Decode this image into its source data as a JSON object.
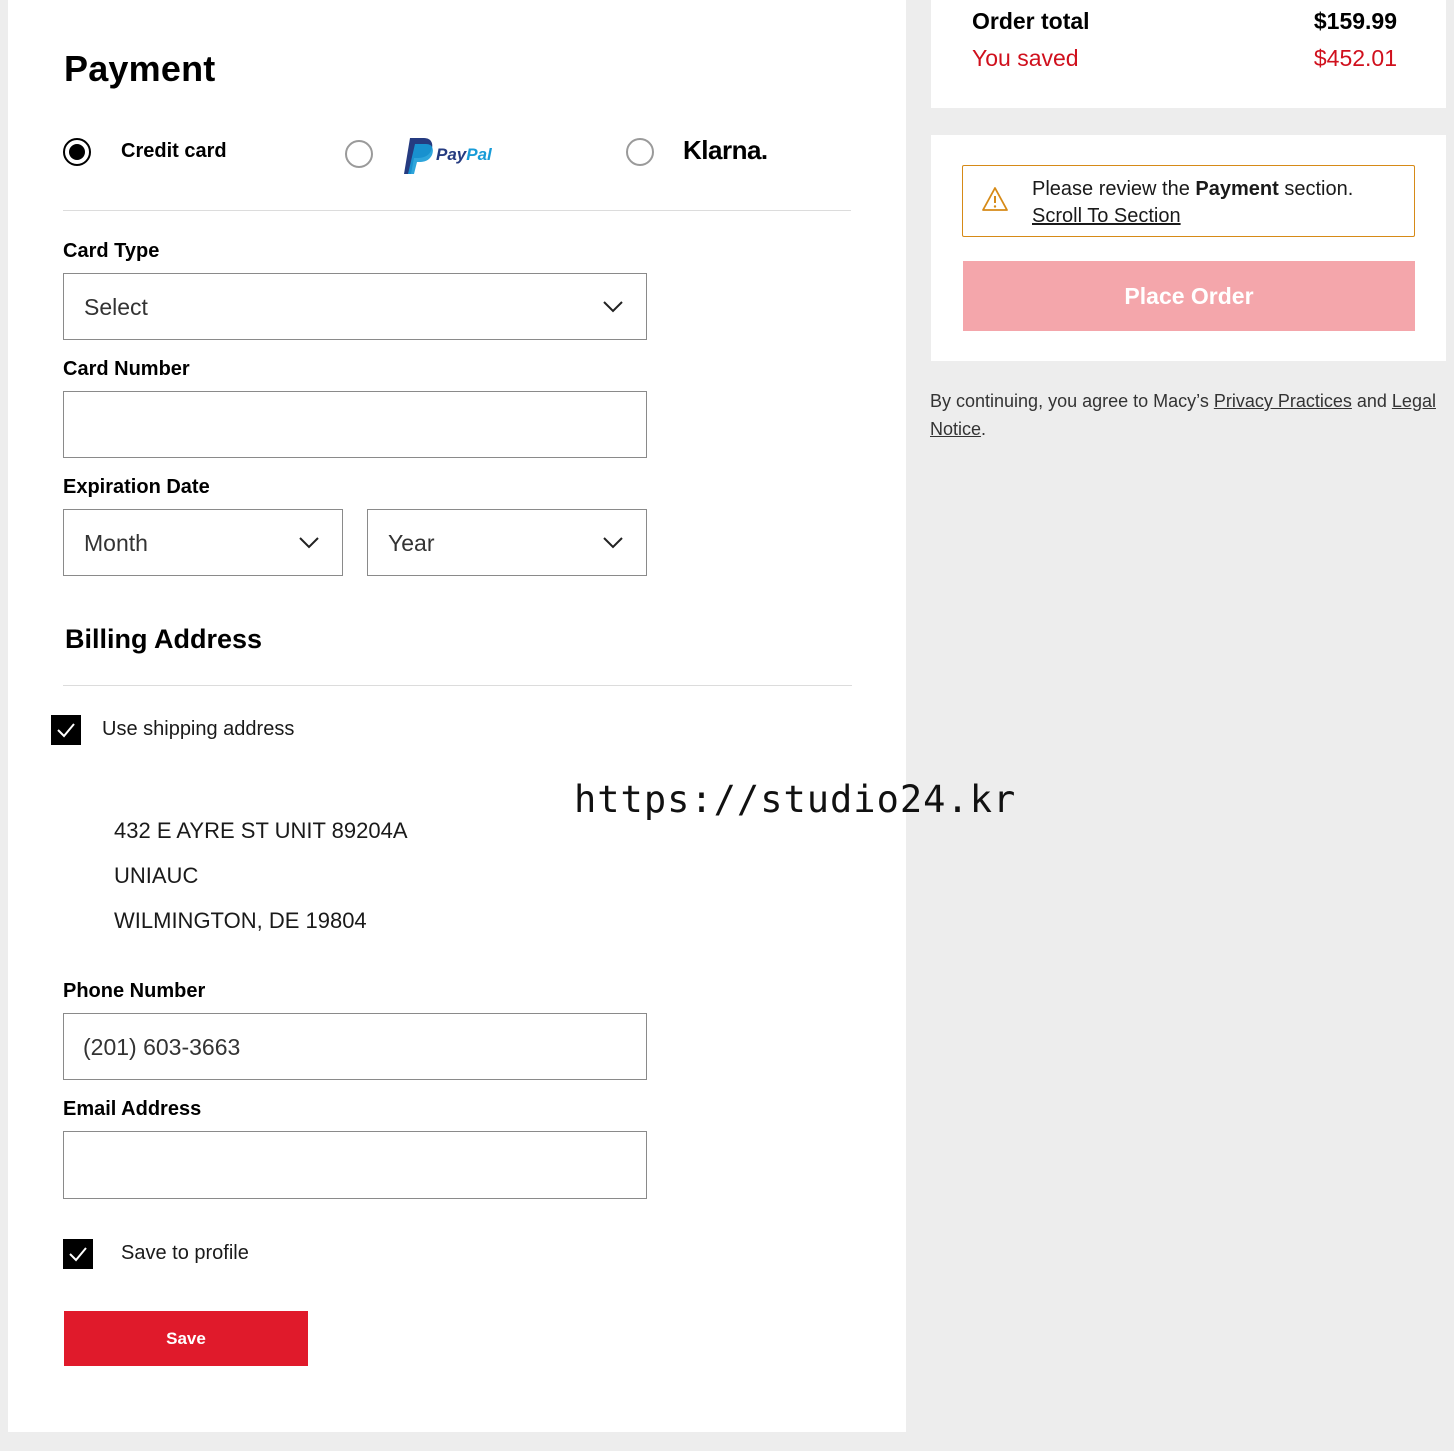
{
  "payment": {
    "title": "Payment",
    "methods": {
      "credit_card": "Credit card",
      "paypal_logo": "PayPal",
      "klarna_logo": "Klarna."
    },
    "selected_method": "credit_card",
    "card_type": {
      "label": "Card Type",
      "value": "Select"
    },
    "card_number": {
      "label": "Card Number",
      "value": ""
    },
    "expiration": {
      "label": "Expiration Date",
      "month": "Month",
      "year": "Year"
    }
  },
  "billing": {
    "title": "Billing Address",
    "use_shipping": {
      "label": "Use shipping address",
      "checked": true
    },
    "address": {
      "line1": "432 E AYRE ST UNIT 89204A",
      "line2": "UNIAUC",
      "line3": "WILMINGTON, DE 19804"
    },
    "phone": {
      "label": "Phone Number",
      "value": "(201) 603-3663"
    },
    "email": {
      "label": "Email Address",
      "value": ""
    },
    "save_to_profile": {
      "label": "Save to profile",
      "checked": true
    },
    "save_button": "Save"
  },
  "summary": {
    "order_total_label": "Order total",
    "order_total_value": "$159.99",
    "saved_label": "You saved",
    "saved_value": "$452.01"
  },
  "alert": {
    "text_before": "Please review the ",
    "text_bold": "Payment",
    "text_after": " section.",
    "link": "Scroll To Section"
  },
  "place_order": "Place Order",
  "legal": {
    "prefix": "By continuing, you agree to Macy’s ",
    "privacy": "Privacy Practices",
    "and": " and ",
    "legal_notice": "Legal Notice",
    "suffix": "."
  },
  "watermark": "https://studio24.kr",
  "colors": {
    "accent_red": "#e01a2b",
    "saved_red": "#d0101d",
    "place_order_disabled": "#f4a6ab",
    "alert_border": "#d68a17"
  }
}
